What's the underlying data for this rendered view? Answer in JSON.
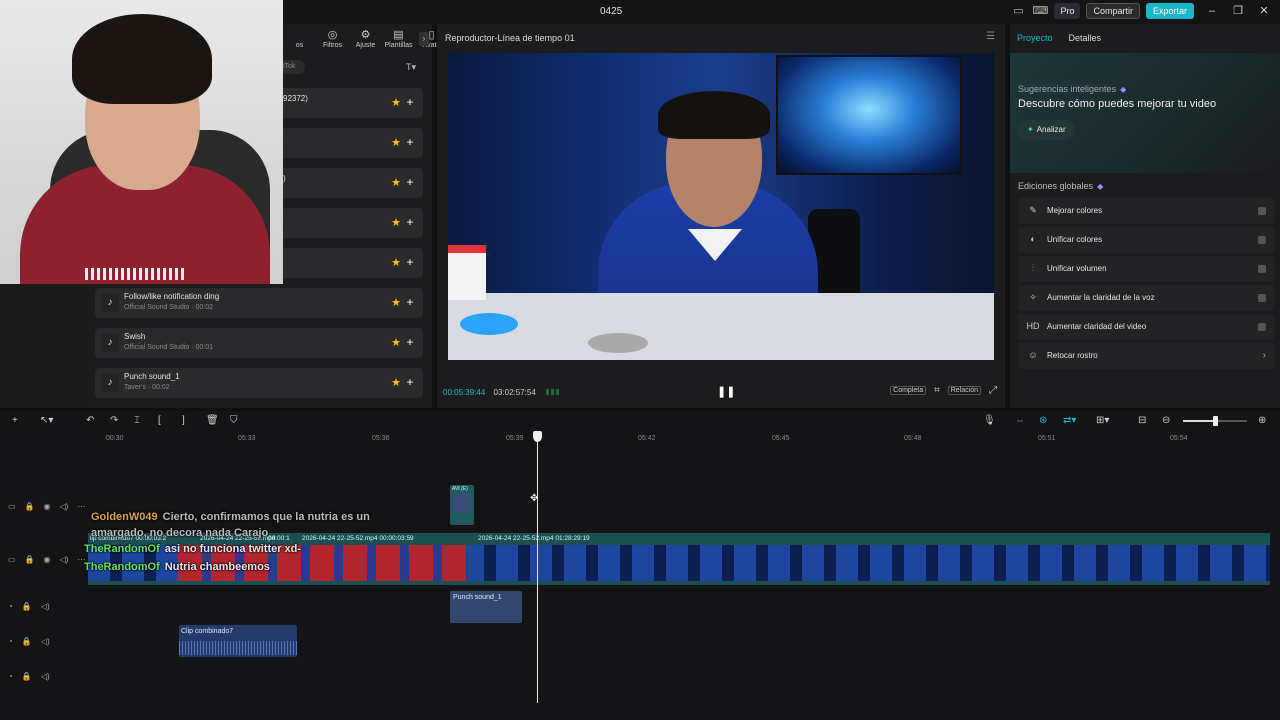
{
  "window": {
    "title": "0425",
    "pro_label": "Pro",
    "share_label": "Compartir",
    "export_label": "Exportar"
  },
  "effects_panel": {
    "tabs": [
      {
        "label": "os",
        "icon": "partial-icon"
      },
      {
        "label": "Filtros",
        "icon": "filter-icon"
      },
      {
        "label": "Ajuste",
        "icon": "sliders-icon"
      },
      {
        "label": "Plantillas",
        "icon": "template-icon"
      },
      {
        "label": "Avata",
        "icon": "avatar-icon"
      }
    ],
    "chip_label": "iTok",
    "sounds": [
      {
        "name": "",
        "meta": "",
        "partial": "92372)"
      },
      {
        "name": "",
        "meta": "",
        "partial": ""
      },
      {
        "name": "",
        "meta": "",
        "partial": ")"
      },
      {
        "name": "",
        "meta": "",
        "partial": ""
      },
      {
        "name": "",
        "meta": "",
        "partial": ""
      },
      {
        "name": "Follow/like notification ding",
        "meta": "Official Sound Studio · 00:02",
        "partial": ""
      },
      {
        "name": "Swish",
        "meta": "Official Sound Studio · 00:01",
        "partial": ""
      },
      {
        "name": "Punch sound_1",
        "meta": "Taver's · 00:02",
        "partial": ""
      }
    ]
  },
  "player": {
    "title": "Reproductor-Línea de tiempo 01",
    "current_time": "00:05:39:44",
    "total_time": "03:02:57:54",
    "full_label": "Completa",
    "ratio_label": "Relación"
  },
  "right_panel": {
    "tabs": [
      "Proyecto",
      "Detalles"
    ],
    "smart_sub": "Sugerencias inteligentes",
    "smart_head": "Descubre cómo puedes mejorar tu video",
    "analyze_label": "Analizar",
    "global_title": "Ediciones globales",
    "global_items": [
      {
        "label": "Mejorar colores",
        "icon": "magic-wand-icon"
      },
      {
        "label": "Unificar colores",
        "icon": "color-drop-icon"
      },
      {
        "label": "Unificar volumen",
        "icon": "equalizer-icon"
      },
      {
        "label": "Aumentar la claridad de la voz",
        "icon": "voice-icon"
      },
      {
        "label": "Aumentar claridad del video",
        "icon": "hd-icon"
      },
      {
        "label": "Retocar rostro",
        "icon": "face-icon"
      }
    ]
  },
  "timeline": {
    "ruler": [
      "00:30",
      "05:33",
      "05:36",
      "05:39",
      "05:42",
      "05:45",
      "05:48",
      "05:51",
      "05:54"
    ],
    "clip_labels": [
      "lip combinado7  00:00:03:2",
      "2026-04-24 22-25-52.mp4",
      "00:00:1",
      "2026-04-24 22-25-52.mp4  00:00:03:59",
      "2026-04-24 22-25-52.mp4  01:28:29:19"
    ],
    "sticker_label": "AVI (E)",
    "audio_clip_label": "Punch sound_1",
    "audio_clip2_label": "Clip combinado7"
  },
  "chat": [
    {
      "user": "GoldenW049",
      "message": "Cierto, confirmamos que la nutria es un amargado, no decora nada Carajo"
    },
    {
      "user": "TheRandomOf",
      "message": "asi no funciona twitter xd-"
    },
    {
      "user": "TheRandomOf",
      "message": "Nutria chambeemos"
    }
  ]
}
